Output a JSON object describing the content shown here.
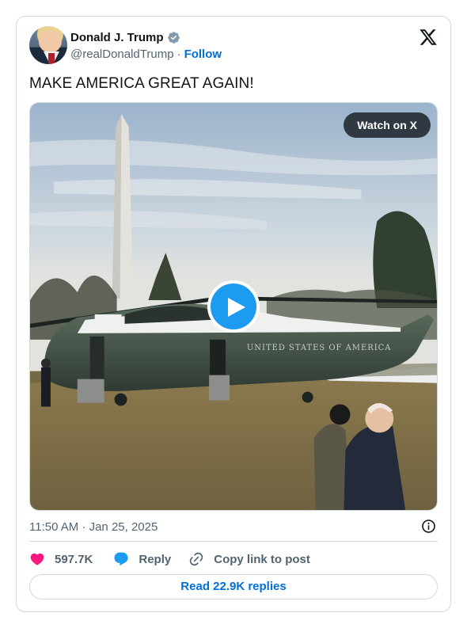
{
  "author": {
    "name": "Donald J. Trump",
    "handle": "@realDonaldTrump",
    "separator": "·",
    "follow_label": "Follow",
    "verified_icon": "verified-badge-icon"
  },
  "tweet": {
    "text": "MAKE AMERICA GREAT AGAIN!",
    "timestamp": "11:50 AM · Jan 25, 2025"
  },
  "media": {
    "watch_label": "Watch on X",
    "helicopter_text": "UNITED STATES OF AMERICA"
  },
  "actions": {
    "likes": "597.7K",
    "reply_label": "Reply",
    "copy_label": "Copy link to post"
  },
  "footer": {
    "read_replies_label": "Read 22.9K replies"
  },
  "colors": {
    "accent": "#1d9bf0",
    "link": "#006fd6",
    "like": "#f91880",
    "muted": "#536471"
  }
}
